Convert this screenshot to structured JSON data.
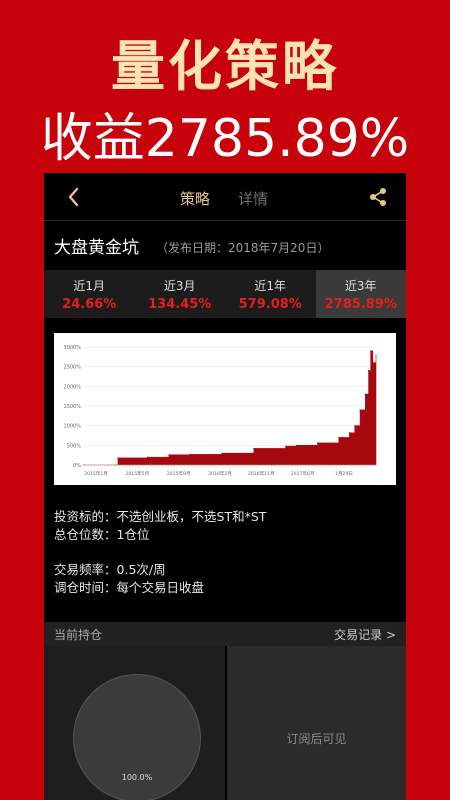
{
  "promo": {
    "title": "量化策略",
    "subtitle": "收益2785.89%"
  },
  "nav": {
    "tabs": [
      {
        "label": "策略",
        "active": true
      },
      {
        "label": "详情",
        "active": false
      }
    ],
    "back_icon": "chevron-left-icon",
    "share_icon": "share-icon"
  },
  "strategy": {
    "name": "大盘黄金坑",
    "publish_date": "（发布日期：2018年7月20日）"
  },
  "periods": [
    {
      "label": "近1月",
      "value": "24.66%",
      "active": false
    },
    {
      "label": "近3月",
      "value": "134.45%",
      "active": false
    },
    {
      "label": "近1年",
      "value": "579.08%",
      "active": false
    },
    {
      "label": "近3年",
      "value": "2785.89%",
      "active": true
    }
  ],
  "chart_data": {
    "type": "area",
    "y_tick_labels": [
      "3000%",
      "2500%",
      "2000%",
      "1500%",
      "1000%",
      "500%",
      "0%"
    ],
    "y_ticks": [
      3000,
      2500,
      2000,
      1500,
      1000,
      500,
      0
    ],
    "x_tick_labels": [
      "2015年1月",
      "2015年5月",
      "2015年9月",
      "2016年2月",
      "2016年11月",
      "2017年6月",
      "1月29日"
    ],
    "ylim": [
      0,
      3000
    ],
    "grid": true,
    "color": "#a5090e",
    "x": [
      0,
      30,
      32,
      60,
      80,
      100,
      130,
      160,
      190,
      200,
      220,
      240,
      250,
      255,
      260,
      265,
      268,
      270,
      272,
      275
    ],
    "values": [
      0,
      0,
      180,
      200,
      260,
      270,
      300,
      420,
      480,
      500,
      560,
      700,
      820,
      1000,
      1400,
      1800,
      2400,
      2900,
      2600,
      2785.89
    ]
  },
  "info": {
    "target_label": "投资标的：",
    "target_value": "不选创业板，不选ST和*ST",
    "positions_label": "总仓位数：",
    "positions_value": "1仓位",
    "frequency_label": "交易频率：",
    "frequency_value": "0.5次/周",
    "rebalance_label": "调仓时间：",
    "rebalance_value": "每个交易日收盘"
  },
  "holdings": {
    "title": "当前持仓",
    "trade_link": "交易记录 >",
    "pie_label": "100.0%",
    "locked_text": "订阅后可见"
  },
  "colors": {
    "background": "#c8020a",
    "accent_gold": "#e8c38a",
    "gain_red": "#e61e1e",
    "chart_fill": "#a5090e"
  }
}
